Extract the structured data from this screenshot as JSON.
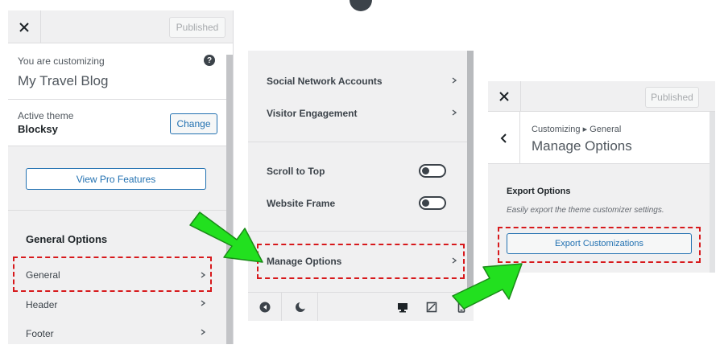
{
  "panel1": {
    "published_label": "Published",
    "customizing_label": "You are customizing",
    "site_title": "My Travel Blog",
    "help_icon_glyph": "?",
    "active_theme_label": "Active theme",
    "theme_name": "Blocksy",
    "change_label": "Change",
    "pro_features_label": "View Pro Features",
    "section_title": "General Options",
    "nav_items": [
      {
        "label": "General"
      },
      {
        "label": "Header"
      },
      {
        "label": "Footer"
      }
    ]
  },
  "panel2": {
    "nav_items": [
      {
        "label": "Social Network Accounts"
      },
      {
        "label": "Visitor Engagement"
      }
    ],
    "toggles": [
      {
        "label": "Scroll to Top",
        "state": "off"
      },
      {
        "label": "Website Frame",
        "state": "off"
      }
    ],
    "manage_label": "Manage Options",
    "footer_icons": [
      "play-back-icon",
      "moon-icon",
      "desktop-icon",
      "tablet-icon",
      "mobile-icon"
    ]
  },
  "panel3": {
    "published_label": "Published",
    "breadcrumb": "Customizing ▸ General",
    "title": "Manage Options",
    "export_title": "Export Options",
    "export_desc": "Easily export the theme customizer settings.",
    "export_button": "Export Customizations"
  },
  "colors": {
    "accent": "#2271b1",
    "annotation_red": "#d7191c",
    "arrow_green": "#22e01f",
    "panel_bg": "#f0f0f1"
  }
}
